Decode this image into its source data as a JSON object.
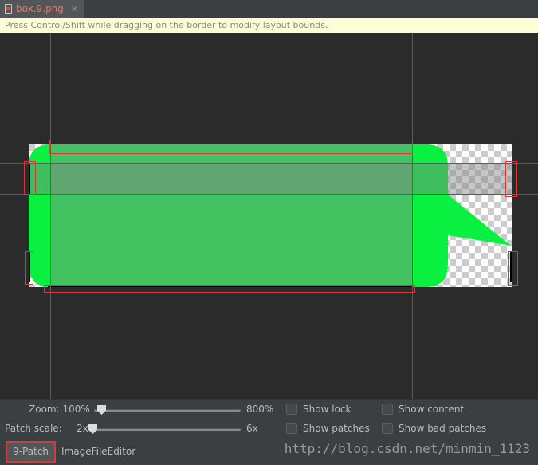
{
  "tab": {
    "filename": "box.9.png",
    "close": "✕",
    "icon": "image-file-icon"
  },
  "hint": "Press Control/Shift while dragging on the border to modify layout bounds.",
  "controls": {
    "zoom_label": "Zoom: 100%",
    "zoom_max": "800%",
    "zoom_value_percent": 100,
    "patch_scale_label": "Patch scale:",
    "patch_min": "2x",
    "patch_max": "6x",
    "patch_scale_value": 2,
    "show_lock": "Show lock",
    "show_content": "Show content",
    "show_patches": "Show patches",
    "show_bad_patches": "Show bad patches"
  },
  "bottom_tabs": [
    "9-Patch",
    "ImageFileEditor"
  ],
  "watermark": "http://blog.csdn.net/minmin_1123",
  "colors": {
    "bubble_green": "#09f040",
    "patch_overlay": "#42b35e",
    "guide_red": "#d83a3a"
  }
}
